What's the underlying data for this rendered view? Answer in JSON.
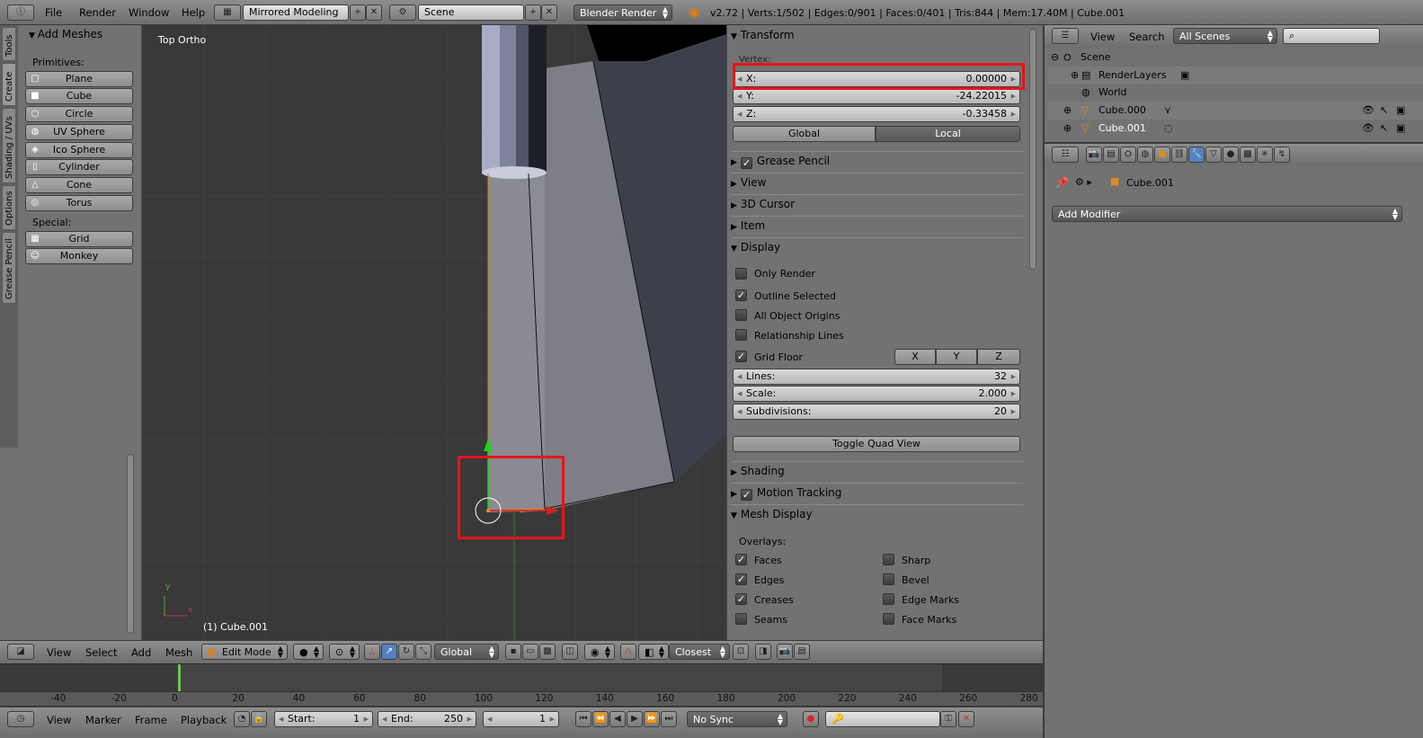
{
  "top_bar": {
    "menus": [
      "File",
      "Render",
      "Window",
      "Help"
    ],
    "screen_layout": "Mirrored Modeling",
    "scene": "Scene",
    "render_engine": "Blender Render",
    "stats": "v2.72 | Verts:1/502 | Edges:0/901 | Faces:0/401 | Tris:844 | Mem:17.40M | Cube.001"
  },
  "tool_shelf": {
    "tabs": [
      "Tools",
      "Create",
      "Shading / UVs",
      "Options",
      "Grease Pencil"
    ],
    "panel_title": "Add Meshes",
    "primitives_label": "Primitives:",
    "primitives": [
      {
        "label": "Plane",
        "icon": "plane-icon"
      },
      {
        "label": "Cube",
        "icon": "cube-icon"
      },
      {
        "label": "Circle",
        "icon": "circle-icon"
      },
      {
        "label": "UV Sphere",
        "icon": "uv-sphere-icon"
      },
      {
        "label": "Ico Sphere",
        "icon": "ico-sphere-icon"
      },
      {
        "label": "Cylinder",
        "icon": "cylinder-icon"
      },
      {
        "label": "Cone",
        "icon": "cone-icon"
      },
      {
        "label": "Torus",
        "icon": "torus-icon"
      }
    ],
    "special_label": "Special:",
    "special": [
      {
        "label": "Grid",
        "icon": "grid-icon"
      },
      {
        "label": "Monkey",
        "icon": "monkey-icon"
      }
    ]
  },
  "viewport": {
    "view_name": "Top Ortho",
    "object_label": "(1) Cube.001",
    "axis_x": "x",
    "axis_y": "y"
  },
  "viewport_header": {
    "menus": [
      "View",
      "Select",
      "Add",
      "Mesh"
    ],
    "mode": "Edit Mode",
    "orientation": "Global",
    "snap_target": "Closest"
  },
  "properties_n_panel": {
    "transform": {
      "title": "Transform",
      "vertex_label": "Vertex:",
      "x_label": "X:",
      "x": "0.00000",
      "y_label": "Y:",
      "y": "-24.22015",
      "z_label": "Z:",
      "z": "-0.33458",
      "global_label": "Global",
      "local_label": "Local"
    },
    "collapsed_panels": {
      "grease_pencil": "Grease Pencil",
      "view": "View",
      "cursor": "3D Cursor",
      "item": "Item",
      "shading": "Shading",
      "motion_tracking": "Motion Tracking"
    },
    "display": {
      "title": "Display",
      "only_render": "Only Render",
      "outline_selected": "Outline Selected",
      "all_origins": "All Object Origins",
      "relationship_lines": "Relationship Lines",
      "grid_floor": "Grid Floor",
      "axis_x": "X",
      "axis_y": "Y",
      "axis_z": "Z",
      "lines_label": "Lines:",
      "lines": "32",
      "scale_label": "Scale:",
      "scale": "2.000",
      "subdiv_label": "Subdivisions:",
      "subdiv": "20",
      "toggle_quad": "Toggle Quad View"
    },
    "mesh_display": {
      "title": "Mesh Display",
      "overlays_label": "Overlays:",
      "faces": "Faces",
      "edges": "Edges",
      "creases": "Creases",
      "seams": "Seams",
      "sharp": "Sharp",
      "bevel": "Bevel",
      "edge_marks": "Edge Marks",
      "face_marks": "Face Marks"
    }
  },
  "outliner": {
    "menus": [
      "View",
      "Search"
    ],
    "filter": "All Scenes",
    "search_placeholder": "",
    "items": {
      "scene": "Scene",
      "render_layers": "RenderLayers",
      "world": "World",
      "cube0": "Cube.000",
      "cube1": "Cube.001"
    }
  },
  "properties_editor": {
    "object_name": "Cube.001",
    "add_modifier": "Add Modifier"
  },
  "timeline": {
    "ticks": [
      "-40",
      "-20",
      "0",
      "20",
      "40",
      "60",
      "80",
      "100",
      "120",
      "140",
      "160",
      "180",
      "200",
      "220",
      "240",
      "260",
      "280"
    ],
    "menus": [
      "View",
      "Marker",
      "Frame",
      "Playback"
    ],
    "start_label": "Start:",
    "start": "1",
    "end_label": "End:",
    "end": "250",
    "current": "1",
    "sync": "No Sync"
  },
  "colors": {
    "highlight_box": "#e8141c",
    "viewport_bg": "#393939",
    "panel_bg": "#727272"
  }
}
